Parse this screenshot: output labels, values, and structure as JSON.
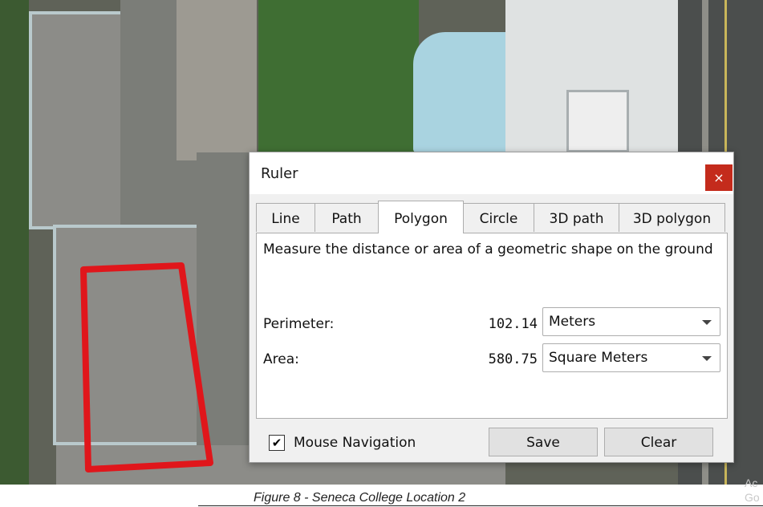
{
  "dialog": {
    "title": "Ruler",
    "close_label": "×",
    "tabs": [
      {
        "label": "Line",
        "active": false
      },
      {
        "label": "Path",
        "active": false
      },
      {
        "label": "Polygon",
        "active": true
      },
      {
        "label": "Circle",
        "active": false
      },
      {
        "label": "3D path",
        "active": false
      },
      {
        "label": "3D polygon",
        "active": false
      }
    ],
    "description": "Measure the distance or area of a geometric shape on the ground",
    "perimeter": {
      "label": "Perimeter:",
      "value": "102.14",
      "unit": "Meters"
    },
    "area": {
      "label": "Area:",
      "value": "580.75",
      "unit": "Square Meters"
    },
    "mouse_navigation": {
      "label": "Mouse Navigation",
      "checked": true,
      "check_glyph": "✔"
    },
    "save_label": "Save",
    "clear_label": "Clear"
  },
  "caption": "Figure 8 - Seneca College Location 2",
  "watermark": {
    "line1": "Ac",
    "line2": "Go"
  },
  "colors": {
    "polygon_outline": "#e0161b",
    "close_button": "#c42b1c",
    "dialog_background": "#f0f0f0"
  }
}
